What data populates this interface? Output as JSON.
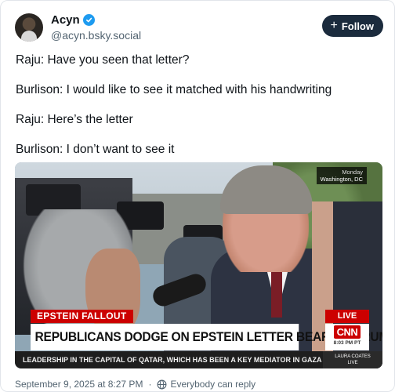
{
  "author": {
    "display_name": "Acyn",
    "handle": "@acyn.bsky.social",
    "verified": true,
    "avatar_icon": "avatar-image"
  },
  "follow_button": {
    "label": "Follow",
    "icon": "plus-icon"
  },
  "post": {
    "lines": [
      "Raju: Have you seen that letter?",
      "Burlison: I would like to see it matched with his handwriting",
      "Raju: Here’s the letter",
      "Burlison: I don’t want to see it"
    ]
  },
  "video": {
    "corner_day": "Monday",
    "corner_location": "Washington, DC",
    "chyron_tag": "EPSTEIN FALLOUT",
    "chyron_headline": "REPUBLICANS DODGE ON EPSTEIN LETTER BEARING TRUMP'S NAME",
    "live_label": "LIVE",
    "network_logo": "CNN",
    "time": "8:03 PM PT",
    "ticker": "LEADERSHIP IN THE CAPITAL OF QATAR, WHICH HAS BEEN A KEY MEDIATOR IN GAZA C",
    "host_line1": "LAURA COATES",
    "host_line2": "LIVE"
  },
  "footer": {
    "timestamp": "September 9, 2025 at 8:27 PM",
    "separator": "·",
    "reply_setting": "Everybody can reply",
    "reply_icon": "globe-icon"
  },
  "colors": {
    "follow_bg": "#1b2b3d",
    "verified_blue": "#1d9bf0",
    "cnn_red": "#cc0000",
    "muted_text": "#536471"
  }
}
